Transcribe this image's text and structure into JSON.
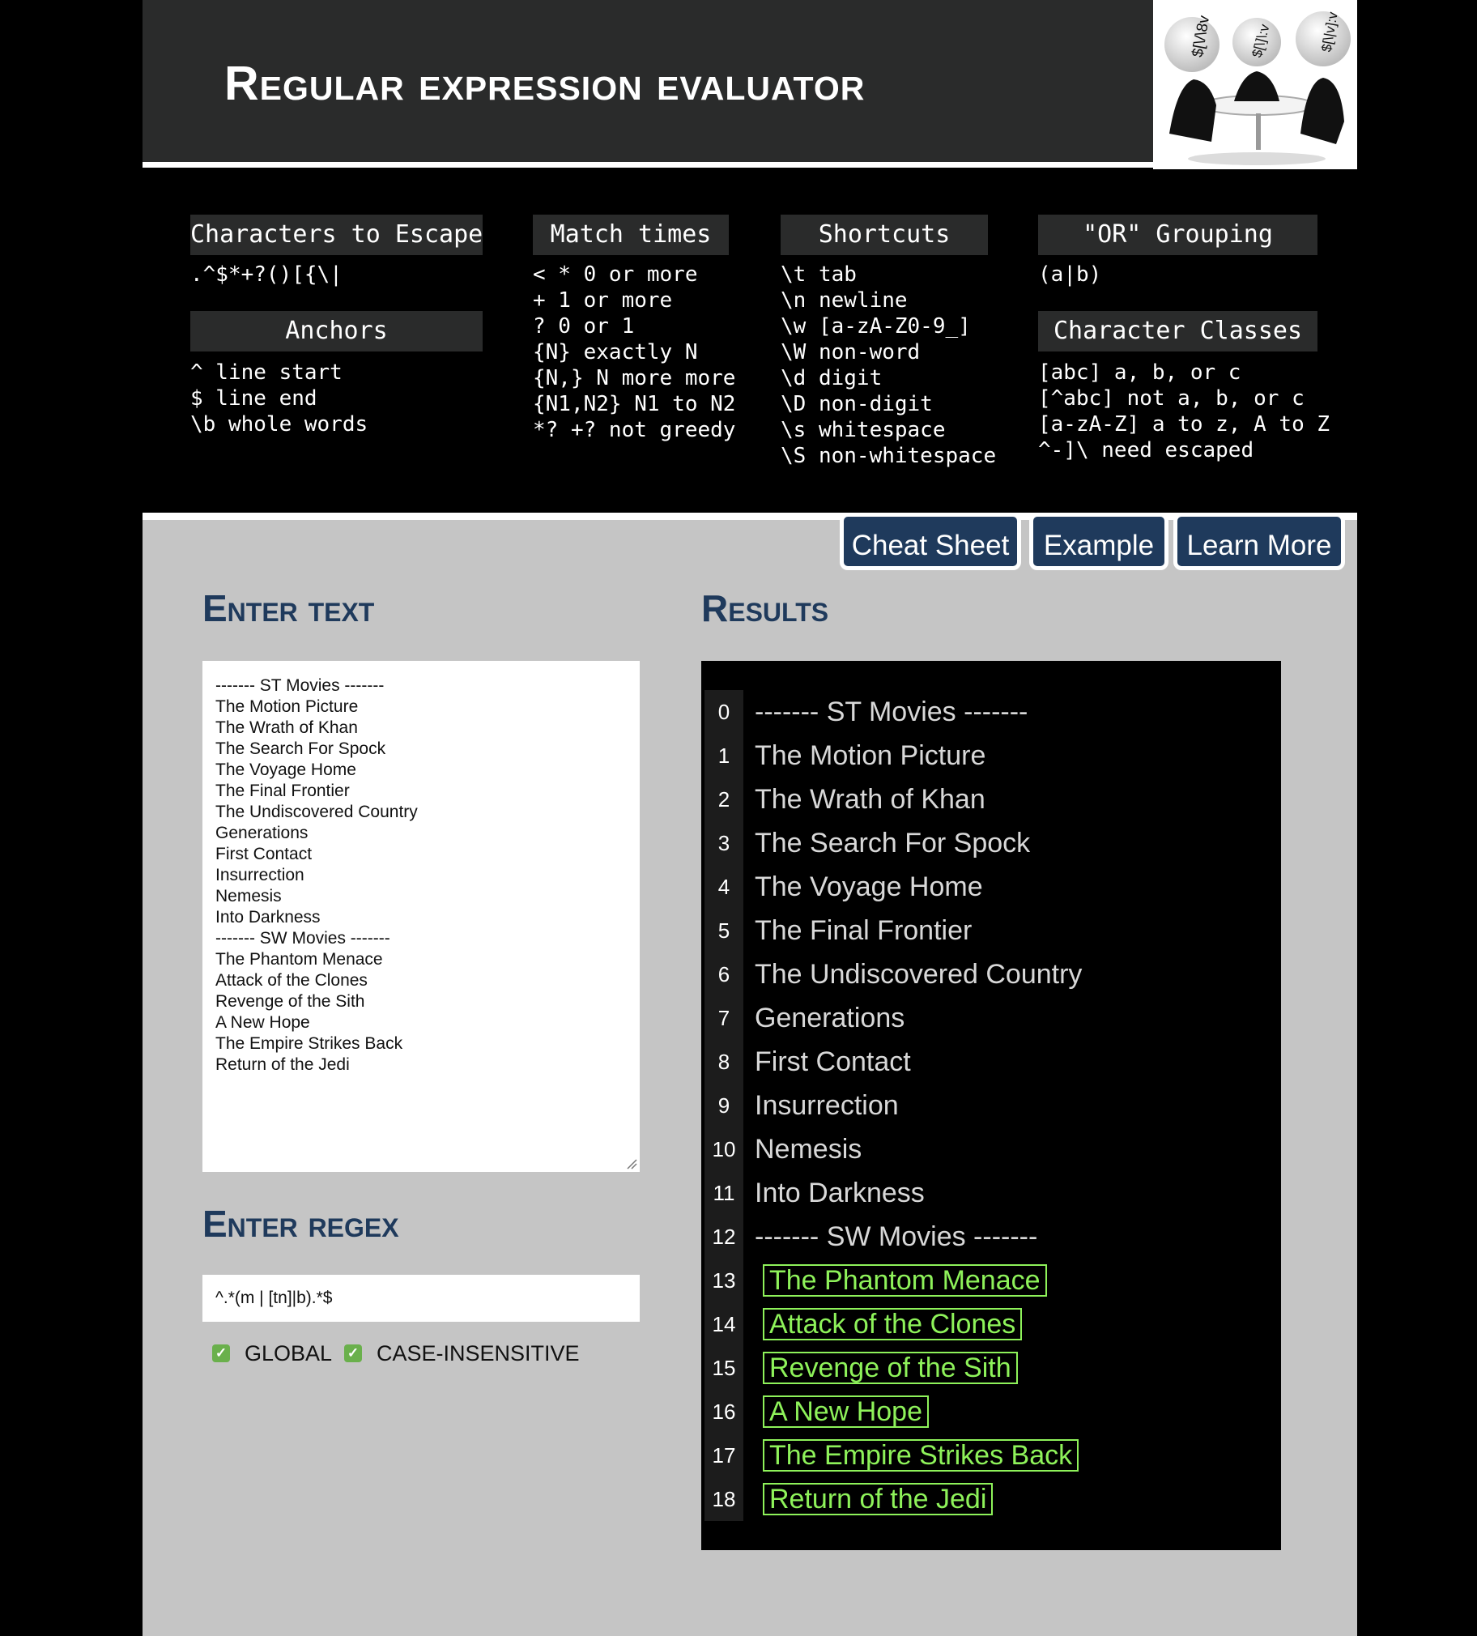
{
  "header": {
    "title": "Regular expression evaluator",
    "logo_labels": [
      "$[\\/\\8v",
      "$[\\]\\:v",
      "$[\\|v]:v"
    ]
  },
  "cheatsheet": {
    "escape": {
      "heading": "Characters to Escape",
      "lines": [
        ".^$*+?()[{\\|"
      ]
    },
    "anchors": {
      "heading": "Anchors",
      "lines": [
        "^ line start",
        "$ line end",
        "\\b whole words"
      ]
    },
    "match_times": {
      "heading": "Match times",
      "lines": [
        "< * 0 or more",
        "+ 1 or more",
        "? 0 or 1",
        "{N} exactly N",
        "{N,} N more more",
        "{N1,N2} N1 to N2",
        "*? +? not greedy"
      ]
    },
    "shortcuts": {
      "heading": "Shortcuts",
      "lines": [
        "\\t tab",
        "\\n newline",
        "\\w [a-zA-Z0-9_]",
        "\\W non-word",
        "\\d digit",
        "\\D non-digit",
        "\\s whitespace",
        "\\S non-whitespace"
      ]
    },
    "or_grouping": {
      "heading": "\"OR\" Grouping",
      "lines": [
        "(a|b)"
      ]
    },
    "char_classes": {
      "heading": "Character Classes",
      "lines": [
        "[abc] a, b, or c",
        "[^abc] not a, b, or c",
        "[a-zA-Z] a to z, A to Z",
        "^-]\\ need escaped"
      ]
    }
  },
  "nav": {
    "cheat_sheet": "Cheat Sheet",
    "example": "Example",
    "learn_more": "Learn More"
  },
  "enter_text": {
    "title": "Enter text",
    "value": "------- ST Movies -------\nThe Motion Picture\nThe Wrath of Khan\nThe Search For Spock\nThe Voyage Home\nThe Final Frontier\nThe Undiscovered Country\nGenerations\nFirst Contact\nInsurrection\nNemesis\nInto Darkness\n------- SW Movies -------\nThe Phantom Menace\nAttack of the Clones\nRevenge of the Sith\nA New Hope\nThe Empire Strikes Back\nReturn of the Jedi"
  },
  "enter_regex": {
    "title": "Enter regex",
    "value": "^.*(m | [tn]|b).*$",
    "options": [
      {
        "label": "GLOBAL",
        "checked": true
      },
      {
        "label": "CASE-INSENSITIVE",
        "checked": true
      }
    ]
  },
  "results": {
    "title": "Results",
    "rows": [
      {
        "num": "0",
        "text": "------- ST Movies -------",
        "match": false
      },
      {
        "num": "1",
        "text": "The Motion Picture",
        "match": false
      },
      {
        "num": "2",
        "text": "The Wrath of Khan",
        "match": false
      },
      {
        "num": "3",
        "text": "The Search For Spock",
        "match": false
      },
      {
        "num": "4",
        "text": "The Voyage Home",
        "match": false
      },
      {
        "num": "5",
        "text": "The Final Frontier",
        "match": false
      },
      {
        "num": "6",
        "text": "The Undiscovered Country",
        "match": false
      },
      {
        "num": "7",
        "text": "Generations",
        "match": false
      },
      {
        "num": "8",
        "text": "First Contact",
        "match": false
      },
      {
        "num": "9",
        "text": "Insurrection",
        "match": false
      },
      {
        "num": "10",
        "text": "Nemesis",
        "match": false
      },
      {
        "num": "11",
        "text": "Into Darkness",
        "match": false
      },
      {
        "num": "12",
        "text": "------- SW Movies -------",
        "match": false
      },
      {
        "num": "13",
        "text": "The Phantom Menace",
        "match": true
      },
      {
        "num": "14",
        "text": "Attack of the Clones",
        "match": true
      },
      {
        "num": "15",
        "text": "Revenge of the Sith",
        "match": true
      },
      {
        "num": "16",
        "text": "A New Hope",
        "match": true
      },
      {
        "num": "17",
        "text": "The Empire Strikes Back",
        "match": true
      },
      {
        "num": "18",
        "text": "Return of the Jedi",
        "match": true
      }
    ]
  },
  "colors": {
    "accent": "#1f3a5c",
    "match": "#8ef25a",
    "panel": "#c5c5c5",
    "header": "#2a2b2b"
  }
}
